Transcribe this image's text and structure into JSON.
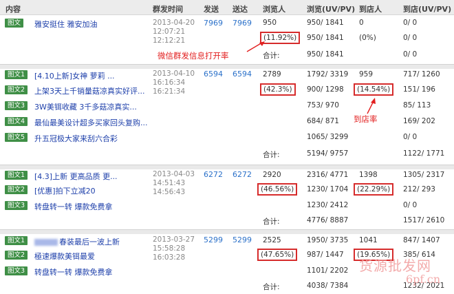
{
  "header": {
    "content": "内容",
    "send_time": "群发时间",
    "sent": "发送",
    "delivered": "送达",
    "viewers": "浏览人",
    "views": "浏览(UV/PV)",
    "to_store": "到店人",
    "store": "到店(UV/PV)"
  },
  "groups": [
    {
      "date": "2013-04-20",
      "times": [
        "12:07:21",
        "12:12:21"
      ],
      "sent": "7969",
      "delivered": "7969",
      "rows": [
        {
          "tag": "图文",
          "title": "雅安挺住 雅安加油",
          "viewers": "950",
          "views": "950/ 1841",
          "to_store": "0",
          "store": "0/ 0"
        }
      ],
      "rate_row": {
        "viewer_rate": "(11.92%)",
        "views": "950/ 1841",
        "store_rate": "(0%)",
        "store": "0/ 0"
      },
      "total": {
        "label": "合计:",
        "views": "950/ 1841",
        "store": "0/ 0"
      }
    },
    {
      "date": "2013-04-10",
      "times": [
        "16:16:34",
        "16:21:34"
      ],
      "sent": "6594",
      "delivered": "6594",
      "rows": [
        {
          "tag": "图文1",
          "title": "[4.10上新]女神 萝莉 ...",
          "viewers": "2789",
          "views": "1792/ 3319",
          "to_store": "959",
          "store": "717/ 1260"
        },
        {
          "tag": "图文2",
          "title": "上架3天上千销量菇凉真实好评...",
          "viewer_rate": "(42.3%)",
          "views": "900/ 1298",
          "store_rate": "(14.54%)",
          "store": "151/ 196"
        },
        {
          "tag": "图文3",
          "title": "3W美铒收藏 3千多菇凉真实...",
          "views": "753/ 970",
          "store": "85/ 113"
        },
        {
          "tag": "图文4",
          "title": "最仙最美设计超多买家回头复购...",
          "views": "684/ 871",
          "store": "169/ 202"
        },
        {
          "tag": "图文5",
          "title": "升五冠极大家来刮六合彩",
          "views": "1065/ 3299",
          "store": "0/ 0"
        }
      ],
      "total": {
        "label": "合计:",
        "views": "5194/ 9757",
        "store": "1122/ 1771"
      }
    },
    {
      "date": "2013-04-03",
      "times": [
        "14:51:43",
        "14:56:43"
      ],
      "sent": "6272",
      "delivered": "6272",
      "rows": [
        {
          "tag": "图文1",
          "title": "[4.3]上新 更高品质 更...",
          "viewers": "2920",
          "views": "2316/ 4771",
          "to_store": "1398",
          "store": "1305/ 2317"
        },
        {
          "tag": "图文2",
          "title": "[优惠]拍下立减20",
          "viewer_rate": "(46.56%)",
          "views": "1230/ 1704",
          "store_rate": "(22.29%)",
          "store": "212/ 293"
        },
        {
          "tag": "图文3",
          "title": "转盘转一转 爆款免费拿",
          "views": "1230/ 2412",
          "store": "0/ 0"
        }
      ],
      "total": {
        "label": "合计:",
        "views": "4776/ 8887",
        "store": "1517/ 2610"
      }
    },
    {
      "date": "2013-03-27",
      "times": [
        "15:58:28",
        "16:03:28"
      ],
      "sent": "5299",
      "delivered": "5299",
      "rows": [
        {
          "tag": "图文1",
          "title": "春装最后一波上新",
          "viewers": "2525",
          "views": "1950/ 3735",
          "to_store": "1041",
          "store": "847/ 1407"
        },
        {
          "tag": "图文2",
          "title": "極速爆款美铒最爱",
          "viewer_rate": "(47.65%)",
          "views": "987/ 1447",
          "store_rate": "(19.65%)",
          "store": "385/ 614"
        },
        {
          "tag": "图文3",
          "title": "转盘转一转 爆款免费拿",
          "views": "1101/ 2202",
          "store": "0/ 0"
        }
      ],
      "total": {
        "label": "合计:",
        "views": "4038/ 7384",
        "store": "1232/ 2021"
      }
    }
  ],
  "annotations": {
    "open_rate": "微信群发信息打开率",
    "store_rate": "到店率"
  },
  "watermark": {
    "main": "货源批发网",
    "url": "6pf.cn"
  },
  "colors": {
    "tag_bg": "#3f8f46",
    "title_link": "#1d3faa",
    "count_blue": "#2a70c9",
    "highlight_red": "#d62b2b",
    "annotation_red": "#e21f1f"
  }
}
